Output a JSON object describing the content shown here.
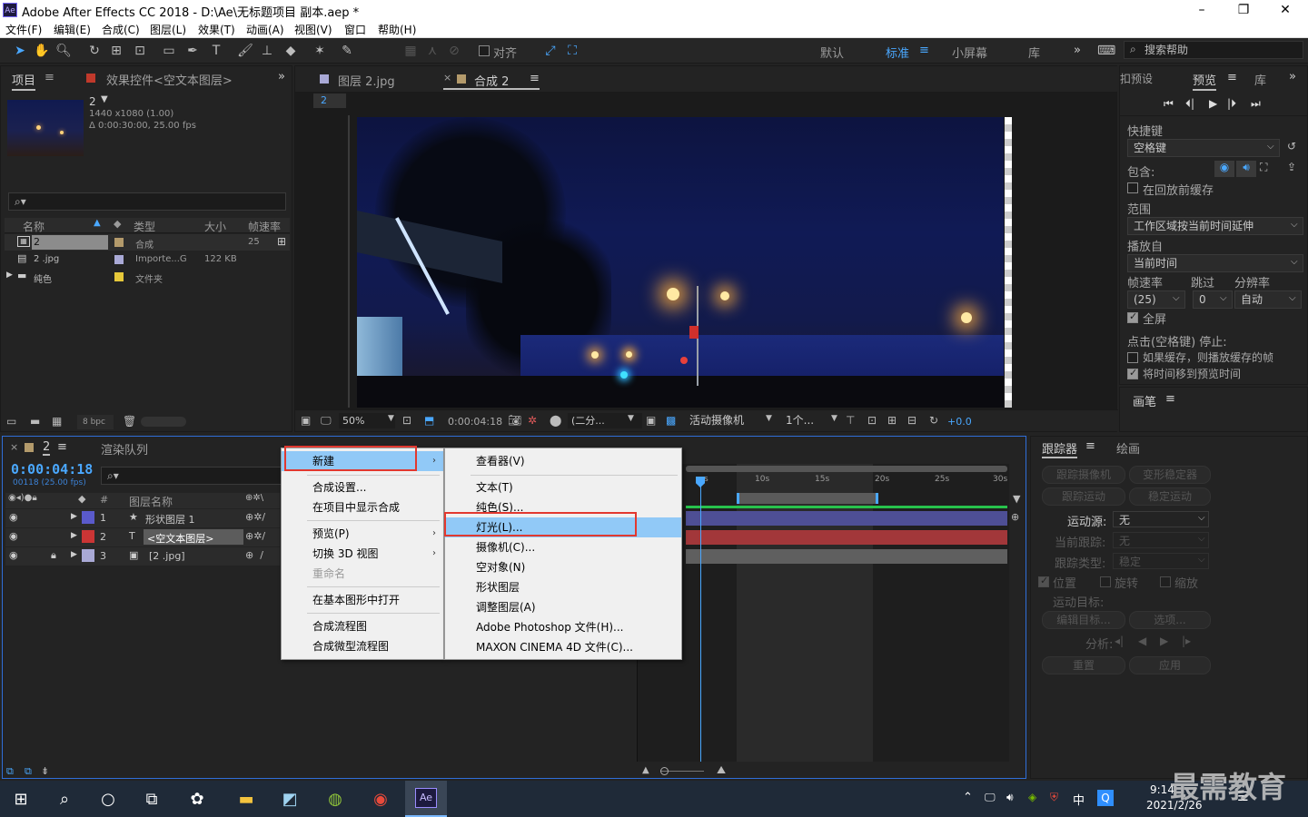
{
  "window": {
    "title": "Adobe After Effects CC 2018 - D:\\Ae\\无标题项目 副本.aep *",
    "app_icon": "Ae",
    "controls": [
      "–",
      "❐",
      "✕"
    ]
  },
  "menubar": [
    "文件(F)",
    "编辑(E)",
    "合成(C)",
    "图层(L)",
    "效果(T)",
    "动画(A)",
    "视图(V)",
    "窗口",
    "帮助(H)"
  ],
  "toolbar": {
    "align_label": "对齐",
    "workspaces": [
      "默认",
      "标准",
      "小屏幕",
      "库"
    ],
    "active_workspace": "标准",
    "search_placeholder": "搜索帮助"
  },
  "project_panel": {
    "tab_project": "项目",
    "tab_effects": "效果控件<空文本图层>",
    "item_name": "2",
    "item_size": "1440 x1080 (1.00)",
    "item_duration": "Δ 0:00:30:00, 25.00 fps",
    "columns": [
      "名称",
      "类型",
      "大小",
      "帧速率"
    ],
    "rows": [
      {
        "name": "2",
        "type": "合成",
        "size": "",
        "rate": "25",
        "color": "#b39a6b"
      },
      {
        "name": "2 .jpg",
        "type": "Importe...G",
        "size": "122 KB",
        "rate": "",
        "color": "#a9a9d6"
      },
      {
        "name": "纯色",
        "type": "文件夹",
        "size": "",
        "rate": "",
        "color": "#e6c83a"
      }
    ],
    "bpc": "8 bpc"
  },
  "comp_panel": {
    "tab_layer": "图层 2.jpg",
    "tab_comp": "合成 2",
    "comp_chip": "2",
    "zoom": "50%",
    "timecode": "0:00:04:18",
    "resolution": "(二分...",
    "camera": "活动摄像机",
    "views": "1个...",
    "exposure": "+0.0"
  },
  "preview_panel": {
    "tab_presets": "扣预设",
    "tab_preview": "预览",
    "tab_library": "库",
    "shortcut_label": "快捷键",
    "shortcut_value": "空格键",
    "include_label": "包含:",
    "cache_before": "在回放前缓存",
    "range_label": "范围",
    "range_value": "工作区域按当前时间延伸",
    "play_from_label": "播放自",
    "play_from_value": "当前时间",
    "framerate_label": "帧速率",
    "skip_label": "跳过",
    "resolution_label": "分辨率",
    "framerate_value": "(25)",
    "skip_value": "0",
    "resolution_value": "自动",
    "fullscreen": "全屏",
    "stop_label": "点击(空格键) 停止:",
    "stop_opt1": "如果缓存，则播放缓存的帧",
    "stop_opt2": "将时间移到预览时间",
    "brush_tab": "画笔"
  },
  "timeline_panel": {
    "tab_comp": "2",
    "tab_render": "渲染队列",
    "timecode": "0:00:04:18",
    "frame_info": "00118 (25.00 fps)",
    "col_num": "#",
    "col_name": "图层名称",
    "layers": [
      {
        "num": "1",
        "type_icon": "★",
        "name": "形状图层 1",
        "color": "#5a5acb"
      },
      {
        "num": "2",
        "type_icon": "T",
        "name": "<空文本图层>",
        "color": "#cb3535"
      },
      {
        "num": "3",
        "type_icon": "▣",
        "name": "[2 .jpg]",
        "color": "#a9a9d6"
      }
    ],
    "ruler": [
      "s",
      "10s",
      "15s",
      "20s",
      "25s",
      "30s"
    ]
  },
  "context_menu": {
    "items": [
      "新建",
      "合成设置...",
      "在项目中显示合成",
      "预览(P)",
      "切换 3D 视图",
      "重命名",
      "在基本图形中打开",
      "合成流程图",
      "合成微型流程图"
    ]
  },
  "submenu": {
    "items": [
      "查看器(V)",
      "文本(T)",
      "纯色(S)...",
      "灯光(L)...",
      "摄像机(C)...",
      "空对象(N)",
      "形状图层",
      "调整图层(A)",
      "Adobe Photoshop 文件(H)...",
      "MAXON CINEMA 4D 文件(C)..."
    ]
  },
  "tracker_panel": {
    "tab_tracker": "跟踪器",
    "tab_paint": "绘画",
    "track_camera": "跟踪摄像机",
    "warp_stabilizer": "变形稳定器",
    "track_motion": "跟踪运动",
    "stabilize_motion": "稳定运动",
    "motion_source_label": "运动源:",
    "motion_source_value": "无",
    "current_track_label": "当前跟踪:",
    "current_track_value": "无",
    "track_type_label": "跟踪类型:",
    "track_type_value": "稳定",
    "position": "位置",
    "rotation": "旋转",
    "scale": "缩放",
    "motion_target": "运动目标:",
    "edit_target": "编辑目标...",
    "options": "选项...",
    "analyze": "分析:",
    "reset": "重置",
    "apply": "应用"
  },
  "taskbar": {
    "time": "9:14",
    "date": "2021/2/26",
    "ime": "中",
    "watermark": "最需教育"
  }
}
